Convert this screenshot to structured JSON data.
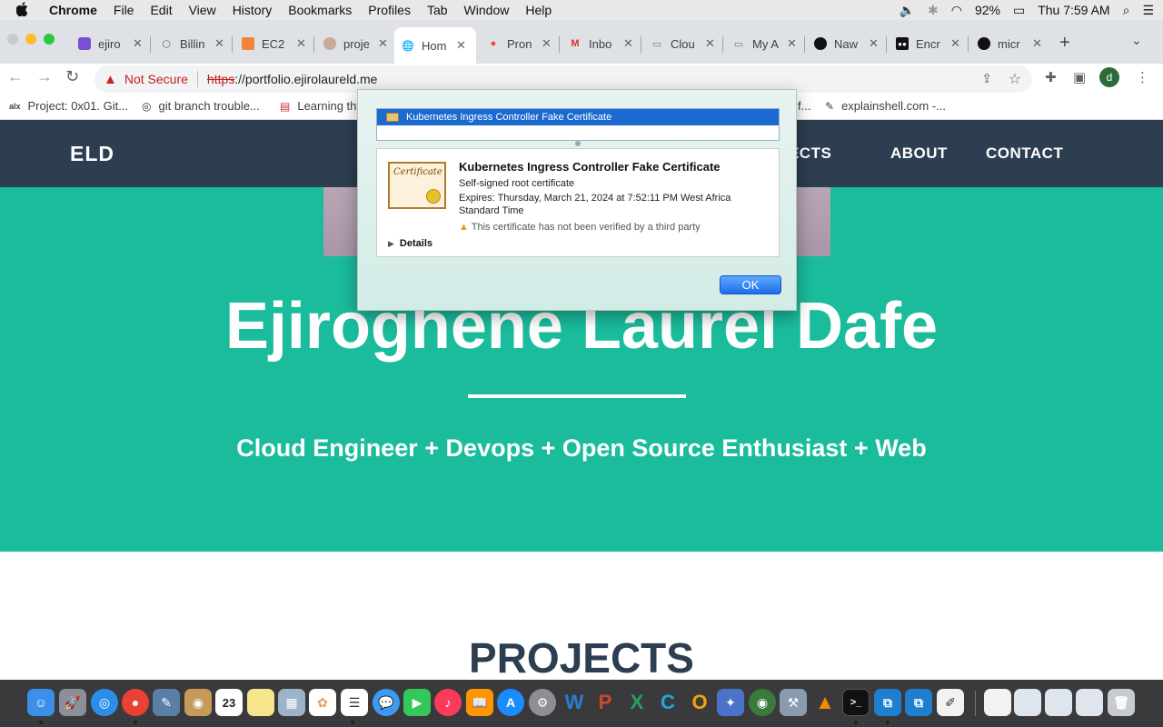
{
  "menubar": {
    "app": "Chrome",
    "items": [
      "File",
      "Edit",
      "View",
      "History",
      "Bookmarks",
      "Profiles",
      "Tab",
      "Window",
      "Help"
    ],
    "battery": "92%",
    "clock": "Thu 7:59 AM"
  },
  "tabs": [
    {
      "label": "ejiro",
      "icon": "purple-square-icon",
      "active": false
    },
    {
      "label": "Billin",
      "icon": "cube-icon",
      "active": false
    },
    {
      "label": "EC2",
      "icon": "aws-icon",
      "active": false
    },
    {
      "label": "proje",
      "icon": "avatar-icon",
      "active": false
    },
    {
      "label": "Hom",
      "icon": "globe-icon",
      "active": true
    },
    {
      "label": "Pron",
      "icon": "flame-icon",
      "active": false
    },
    {
      "label": "Inbo",
      "icon": "gmail-icon",
      "active": false
    },
    {
      "label": "Clou",
      "icon": "folder-icon",
      "active": false
    },
    {
      "label": "My A",
      "icon": "folder-icon",
      "active": false
    },
    {
      "label": "Naw",
      "icon": "github-icon",
      "active": false
    },
    {
      "label": "Encr",
      "icon": "medium-icon",
      "active": false
    },
    {
      "label": "micr",
      "icon": "github-icon",
      "active": false
    }
  ],
  "omnibox": {
    "not_secure": "Not Secure",
    "scheme": "https",
    "rest": "://portfolio.ejirolaureld.me"
  },
  "bookmarks": [
    {
      "label": "Project: 0x01. Git...",
      "icon": "alx-icon"
    },
    {
      "label": "git branch trouble...",
      "icon": "stackoverflow-icon"
    },
    {
      "label": "Learning th",
      "icon": "doc-icon"
    },
    {
      "label": "f...",
      "icon": ""
    },
    {
      "label": "explainshell.com -...",
      "icon": "shell-icon"
    }
  ],
  "site": {
    "brand": "ELD",
    "nav": [
      "PROJECTS",
      "ABOUT",
      "CONTACT"
    ],
    "nav_visible": [
      "JECTS",
      "ABOUT",
      "CONTACT"
    ],
    "name": "Ejiroghene Laurel Dafe",
    "tagline": "Cloud Engineer + Devops + Open Source Enthusiast + Web",
    "section_title": "PROJECTS",
    "colors": {
      "nav": "#2c3e50",
      "hero": "#1abc9c",
      "section_text": "#2c3e50"
    }
  },
  "cert_dialog": {
    "list_item": "Kubernetes Ingress Controller Fake Certificate",
    "title": "Kubernetes Ingress Controller Fake Certificate",
    "type": "Self-signed root certificate",
    "expires": "Expires: Thursday, March 21, 2024 at 7:52:11 PM West Africa",
    "expires_cont": "Standard Time",
    "warning": "This certificate has not been verified by a third party",
    "details": "Details",
    "ok": "OK",
    "cert_image_text": "Certificate"
  },
  "dock": {
    "items": [
      "finder-icon",
      "launchpad-icon",
      "safari-icon",
      "chrome-icon",
      "preview-icon",
      "contacts-icon",
      "calendar-icon",
      "notes-icon",
      "photos-viewer-icon",
      "photos-icon",
      "reminders-icon",
      "messages-icon",
      "facetime-icon",
      "music-icon",
      "books-icon",
      "appstore-icon",
      "settings-icon",
      "word-icon",
      "powerpoint-icon",
      "excel-icon",
      "c-icon",
      "o-icon",
      "teams-icon",
      "network-icon",
      "tool-icon",
      "vlc-icon",
      "terminal-icon",
      "vscode-icon",
      "vscode2-icon",
      "textedit-icon",
      "doc-icon",
      "window-icon",
      "window2-icon",
      "window3-icon",
      "trash-icon"
    ],
    "calendar_day": "23"
  }
}
